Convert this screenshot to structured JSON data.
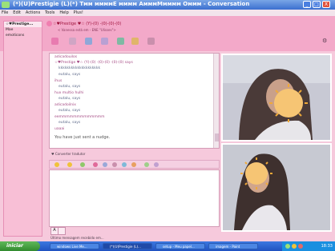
{
  "window": {
    "title": "(*)(U)Prestigie (L)(*) Tᴍᴍ ᴍᴍᴍᴍE ᴍᴍᴍᴍ AᴍᴍᴍMᴍᴍᴍᴍ Oᴍᴍᴍ - Conversation",
    "min": "_",
    "max": "□",
    "close": "X"
  },
  "menu": [
    "File",
    "Edit",
    "Actions",
    "Tools",
    "Help",
    "Plus!"
  ],
  "sidebar": {
    "items": [
      {
        "label": "☆♥Prestige..."
      },
      {
        "label": "Mae"
      },
      {
        "label": "emoticons"
      }
    ]
  },
  "header": {
    "contact_name": "☆♥Prestige ♥☆ (Y)-(0) -(0)-(0)-(0)",
    "subline": "< Vanessa está em - ENE \"Ulisses\">"
  },
  "log": {
    "lines": [
      {
        "kind": "sender",
        "text": "adicadouilos"
      },
      {
        "kind": "sender",
        "text": "☆♥Prestige ♥☆ (Y)-(0)  -(0)-(0) -(0)-(0) says"
      },
      {
        "kind": "msg",
        "text": "kkkkkkkkkkkkkkkkkkkk"
      },
      {
        "kind": "msg",
        "text": "eutalu, says"
      },
      {
        "kind": "sender",
        "text": "ihus"
      },
      {
        "kind": "msg",
        "text": "eutalu, says"
      },
      {
        "kind": "sender",
        "text": "hux multio hulhi"
      },
      {
        "kind": "msg",
        "text": "eutalu, says"
      },
      {
        "kind": "sender",
        "text": "adicadoilnix"
      },
      {
        "kind": "msg",
        "text": "eutalu, says"
      },
      {
        "kind": "sender",
        "text": "eemmmmmmmmmmmmm"
      },
      {
        "kind": "msg",
        "text": "eutalu, says"
      },
      {
        "kind": "sender",
        "text": "uaaai"
      }
    ],
    "nudge": "You have just sent a nudge."
  },
  "composer": {
    "label": "♥ Converter tradutor",
    "font_btn": "A",
    "typing_status": "Último mensagem recebido em..."
  },
  "taskbar": {
    "start": "iniciar",
    "tasks": [
      "windows Live Me...",
      "(*)(U)Prestigie (L)...",
      "setup - Meu papel...",
      "imagem - Paint"
    ],
    "clock": "18:33"
  },
  "colors": {
    "pink_band": "#f3a9c9",
    "sidebar": "#f8bfd6",
    "taskbar": "#2052c0",
    "start": "#318a2e"
  }
}
